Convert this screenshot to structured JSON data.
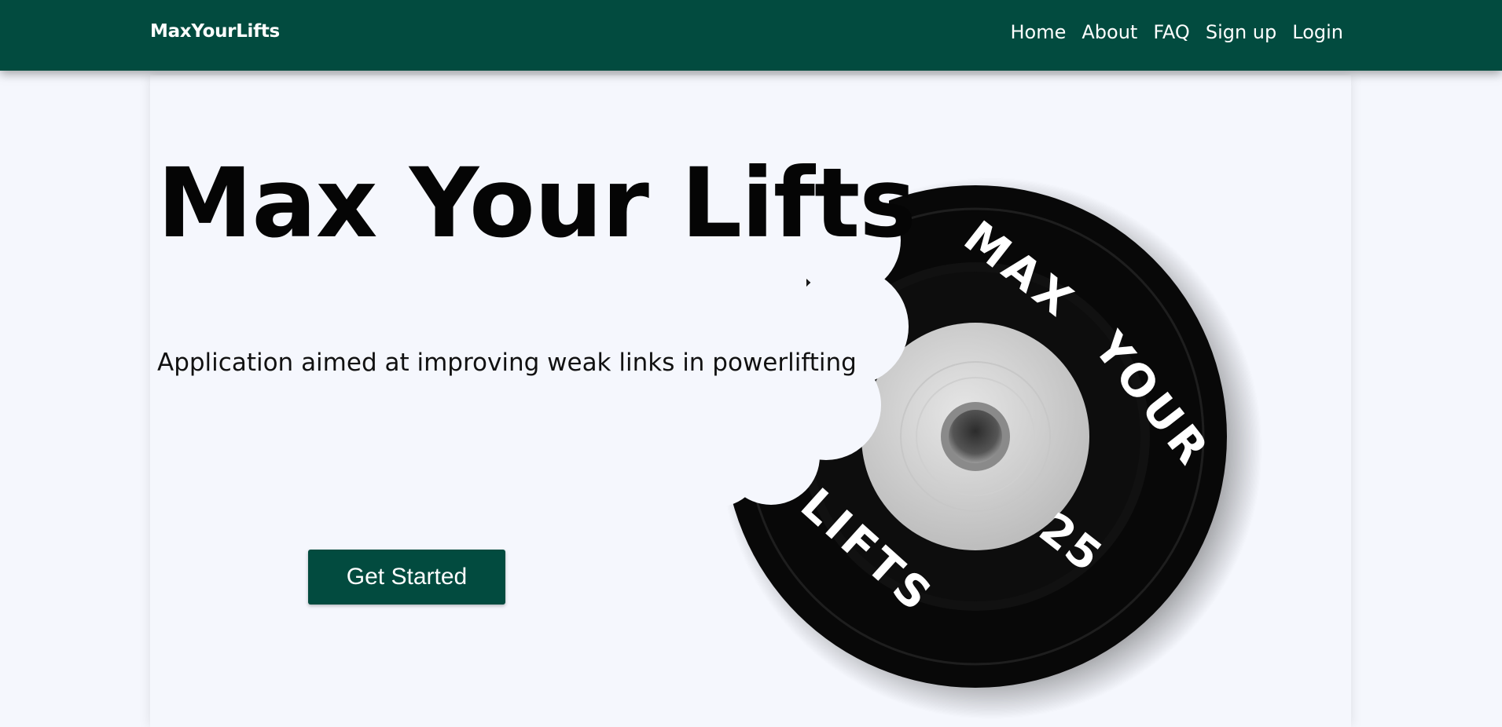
{
  "nav": {
    "brand": "MaxYourLifts",
    "links": [
      "Home",
      "About",
      "FAQ",
      "Sign up",
      "Login"
    ]
  },
  "hero": {
    "title": "Max Your Lifts",
    "subtitle": "Application aimed at improving weak links in powerlifting",
    "cta_label": "Get Started"
  },
  "plate": {
    "text_top_left": "MAX",
    "text_top_right": "YOUR",
    "text_bottom": "LIFTS",
    "weight": "25"
  },
  "colors": {
    "primary": "#024b3f",
    "background": "#f5f7fd",
    "plate": "#0a0a0a",
    "hub": "#d9d9d9"
  }
}
